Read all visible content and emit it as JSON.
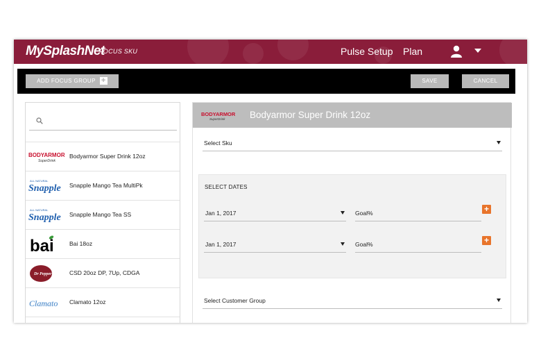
{
  "header": {
    "logo": "MySplashNet",
    "subtitle": "FOCUS SKU",
    "nav": [
      "Pulse Setup",
      "Plan"
    ],
    "icons": [
      "user-icon",
      "caret-down-icon"
    ],
    "color": "#8a1d3a"
  },
  "toolbar": {
    "add_group_label": "ADD FOCUS GROUP",
    "save_label": "SAVE",
    "cancel_label": "CANCEL"
  },
  "search": {
    "placeholder": "",
    "value": ""
  },
  "sku_list": [
    {
      "brand": "BODYARMOR",
      "label": "Bodyarmor Super Drink 12oz"
    },
    {
      "brand": "Snapple",
      "label": "Snapple Mango Tea MultiPk"
    },
    {
      "brand": "Snapple",
      "label": "Snapple Mango Tea SS"
    },
    {
      "brand": "bai",
      "label": "Bai 18oz"
    },
    {
      "brand": "Dr Pepper",
      "label": "CSD 20oz DP, 7Up, CDGA"
    },
    {
      "brand": "Clamato",
      "label": "Clamato 12oz"
    }
  ],
  "detail": {
    "brand_logo": "BODYARMOR",
    "title": "Bodyarmor Super Drink 12oz",
    "select_sku": "Select Sku",
    "dates_title": "SELECT DATES",
    "date_rows": [
      {
        "date": "Jan 1, 2017",
        "goal": "Goal%"
      },
      {
        "date": "Jan 1, 2017",
        "goal": "Goal%"
      }
    ],
    "select_customer_group": "Select Customer Group"
  },
  "colors": {
    "accent_orange": "#e8742b",
    "toolbar_bg": "#000000",
    "button_gray": "#b9b9b9"
  }
}
